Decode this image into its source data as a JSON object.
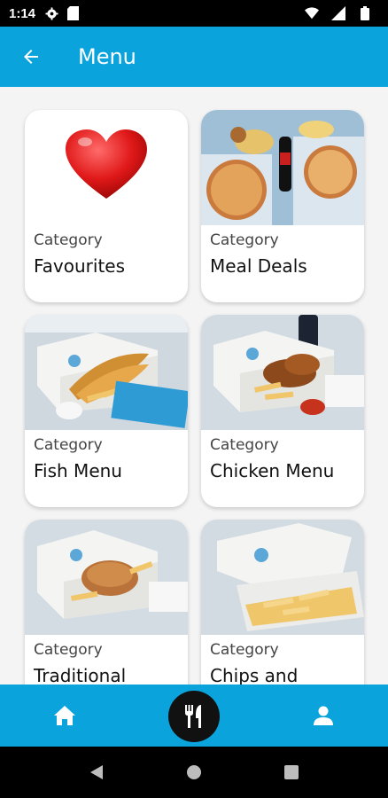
{
  "status_bar": {
    "time": "1:14",
    "icons": [
      "gear-icon",
      "sd-card-icon",
      "wifi-icon",
      "signal-icon",
      "battery-icon"
    ]
  },
  "app_bar": {
    "title": "Menu",
    "back_icon": "arrow-left-icon"
  },
  "categories": [
    {
      "label": "Category",
      "name": "Favourites",
      "image": "heart-icon"
    },
    {
      "label": "Category",
      "name": "Meal Deals",
      "image": "pizza-meal-photo"
    },
    {
      "label": "Category",
      "name": "Fish Menu",
      "image": "fish-and-chips-photo"
    },
    {
      "label": "Category",
      "name": "Chicken Menu",
      "image": "chicken-wings-photo"
    },
    {
      "label": "Category",
      "name": "Traditional",
      "image": "pie-and-chips-photo"
    },
    {
      "label": "Category",
      "name": "Chips and",
      "image": "chips-box-photo"
    }
  ],
  "bottom_nav": {
    "items": [
      "home-icon",
      "cutlery-icon",
      "person-icon"
    ],
    "active": "cutlery-icon"
  },
  "system_nav": [
    "back-triangle-icon",
    "home-circle-icon",
    "recents-square-icon"
  ],
  "colors": {
    "primary": "#0aa3dc",
    "background": "#f4f4f4",
    "active_nav": "#111111",
    "heart": "#e01818"
  }
}
